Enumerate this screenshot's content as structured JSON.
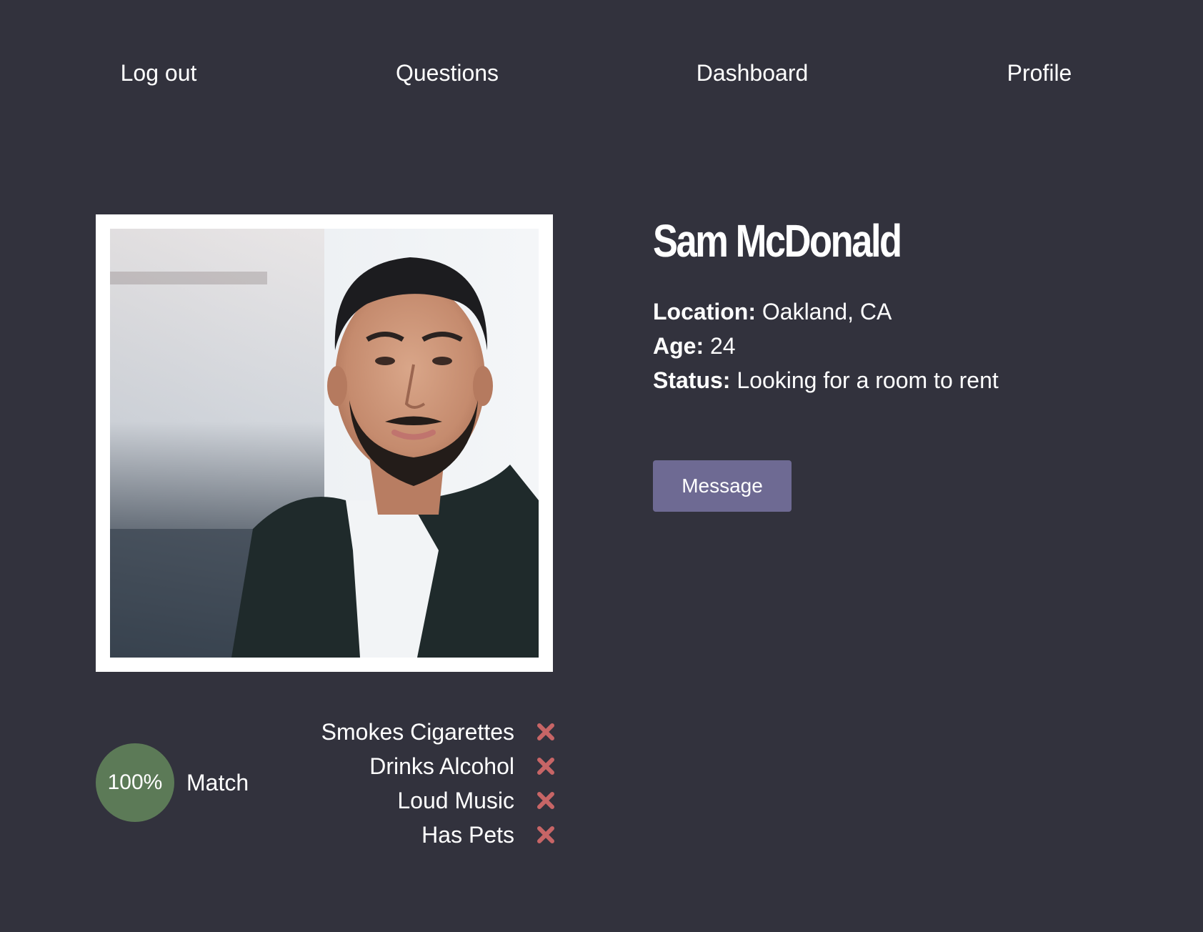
{
  "nav": {
    "items": [
      {
        "label": "Log out"
      },
      {
        "label": "Questions"
      },
      {
        "label": "Dashboard"
      },
      {
        "label": "Profile"
      }
    ]
  },
  "profile": {
    "name": "Sam McDonald",
    "location_label": "Location:",
    "location": "Oakland, CA",
    "age_label": "Age:",
    "age": "24",
    "status_label": "Status:",
    "status": "Looking for a room to rent",
    "photo_alt": "Profile photo",
    "message_button": "Message"
  },
  "match": {
    "percent": "100%",
    "label": "Match"
  },
  "preferences": [
    {
      "label": "Smokes Cigarettes",
      "icon": "x-icon"
    },
    {
      "label": "Drinks Alcohol",
      "icon": "x-icon"
    },
    {
      "label": "Loud Music",
      "icon": "x-icon"
    },
    {
      "label": "Has Pets",
      "icon": "x-icon"
    }
  ],
  "colors": {
    "background": "#32323d",
    "button": "#6e6a93",
    "match": "#5c7a57",
    "x_icon": "#c76566"
  }
}
